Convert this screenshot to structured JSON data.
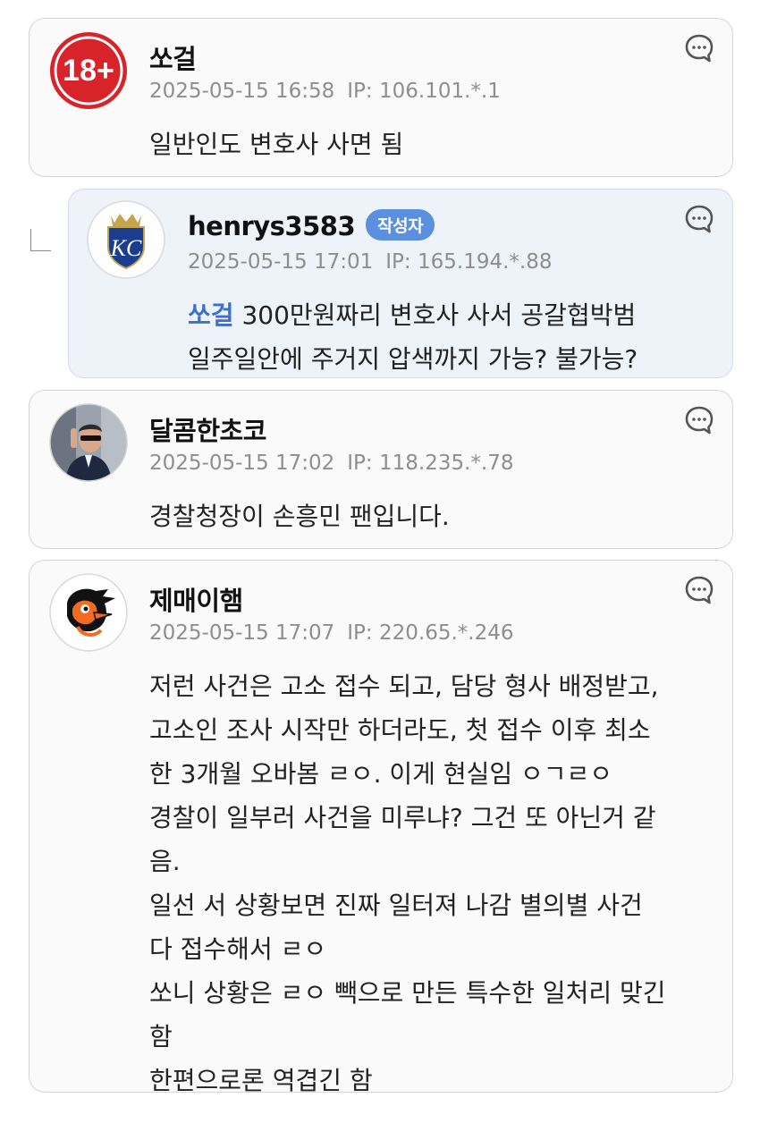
{
  "comments": [
    {
      "nickname": "쏘걸",
      "date": "2025-05-15 16:58",
      "ip": "IP: 106.101.*.1",
      "avatar_icon": "adult-18plus-icon",
      "lines": [
        "일반인도 변호사 사면 됨"
      ]
    },
    {
      "nickname": "henrys3583",
      "badge": "작성자",
      "date": "2025-05-15 17:01",
      "ip": "IP: 165.194.*.88",
      "avatar_icon": "kc-royals-logo-icon",
      "mention": "쏘걸",
      "lines": [
        "300만원짜리 변호사 사서 공갈협박범",
        "일주일안에 주거지 압색까지 가능? 불가능?"
      ]
    },
    {
      "nickname": "달콤한초코",
      "date": "2025-05-15 17:02",
      "ip": "IP: 118.235.*.78",
      "avatar_icon": "profile-photo",
      "lines": [
        "경찰청장이 손흥민 팬입니다."
      ]
    },
    {
      "nickname": "제매이햄",
      "date": "2025-05-15 17:07",
      "ip": "IP: 220.65.*.246",
      "avatar_icon": "orioles-bird-logo-icon",
      "lines": [
        "저런 사건은 고소 접수 되고, 담당 형사 배정받고,",
        "고소인 조사 시작만 하더라도, 첫 접수 이후 최소",
        "한 3개월 오바봄 ㄹㅇ. 이게 현실임 ㅇㄱㄹㅇ",
        "경찰이 일부러 사건을 미루냐? 그건 또 아닌거 같",
        "음.",
        "일선 서 상황보면 진짜 일터져 나감 별의별 사건",
        "다 접수해서 ㄹㅇ",
        "쏘니 상황은 ㄹㅇ 빽으로 만든 특수한 일처리 맞긴",
        "함",
        "한편으로론 역겹긴 함"
      ]
    }
  ],
  "colors": {
    "badge": "#5b8fe0",
    "mention": "#3f6fce",
    "reply_bg": "#eef3fa",
    "card_bg": "#fafafa"
  }
}
